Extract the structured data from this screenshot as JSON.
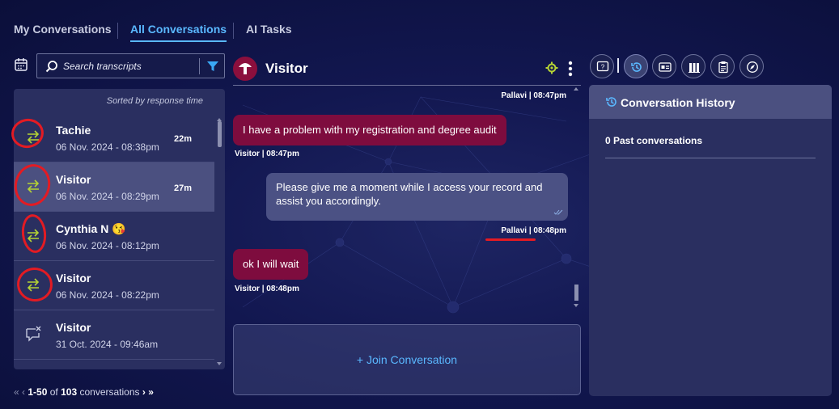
{
  "tabs": [
    {
      "label": "My Conversations"
    },
    {
      "label": "All Conversations"
    },
    {
      "label": "AI Tasks"
    }
  ],
  "search": {
    "placeholder": "Search transcripts"
  },
  "list": {
    "sorted_label": "Sorted by response time",
    "items": [
      {
        "name": "Tachie",
        "date": "06 Nov. 2024 - 08:38pm",
        "age": "22m",
        "icon": "transfer-icon"
      },
      {
        "name": "Visitor",
        "date": "06 Nov. 2024 - 08:29pm",
        "age": "27m",
        "icon": "transfer-icon"
      },
      {
        "name": "Cynthia N 😘",
        "date": "06 Nov. 2024 - 08:12pm",
        "age": "",
        "icon": "transfer-icon"
      },
      {
        "name": "Visitor",
        "date": "06 Nov. 2024 - 08:22pm",
        "age": "",
        "icon": "transfer-icon"
      },
      {
        "name": "Visitor",
        "date": "31 Oct. 2024 - 09:46am",
        "age": "",
        "icon": "chat-closed-icon"
      }
    ]
  },
  "pager": {
    "range": "1-50",
    "of": "of",
    "total": "103",
    "suffix": "conversations"
  },
  "chat": {
    "title": "Visitor",
    "messages": [
      {
        "from": "agent",
        "meta": "Pallavi  |  08:47pm",
        "text": ""
      },
      {
        "from": "visitor",
        "text": "I have a problem with my registration and degree audit",
        "meta": "Visitor  |  08:47pm"
      },
      {
        "from": "agent",
        "text": "Please give me a moment while I access your record and assist you accordingly.",
        "meta": "Pallavi  |  08:48pm"
      },
      {
        "from": "visitor",
        "text": "ok I will wait",
        "meta": "Visitor  |  08:48pm"
      }
    ],
    "join_label": "+ Join Conversation"
  },
  "right_panel": {
    "title": "Conversation History",
    "past_count_label": "0 Past conversations"
  },
  "colors": {
    "accent": "#5ab8ff",
    "visitor_bubble": "#7e0c3e",
    "agent_bubble": "#4b5184",
    "transfer_icon": "#b5d334",
    "annotation_red": "#e31b23"
  }
}
